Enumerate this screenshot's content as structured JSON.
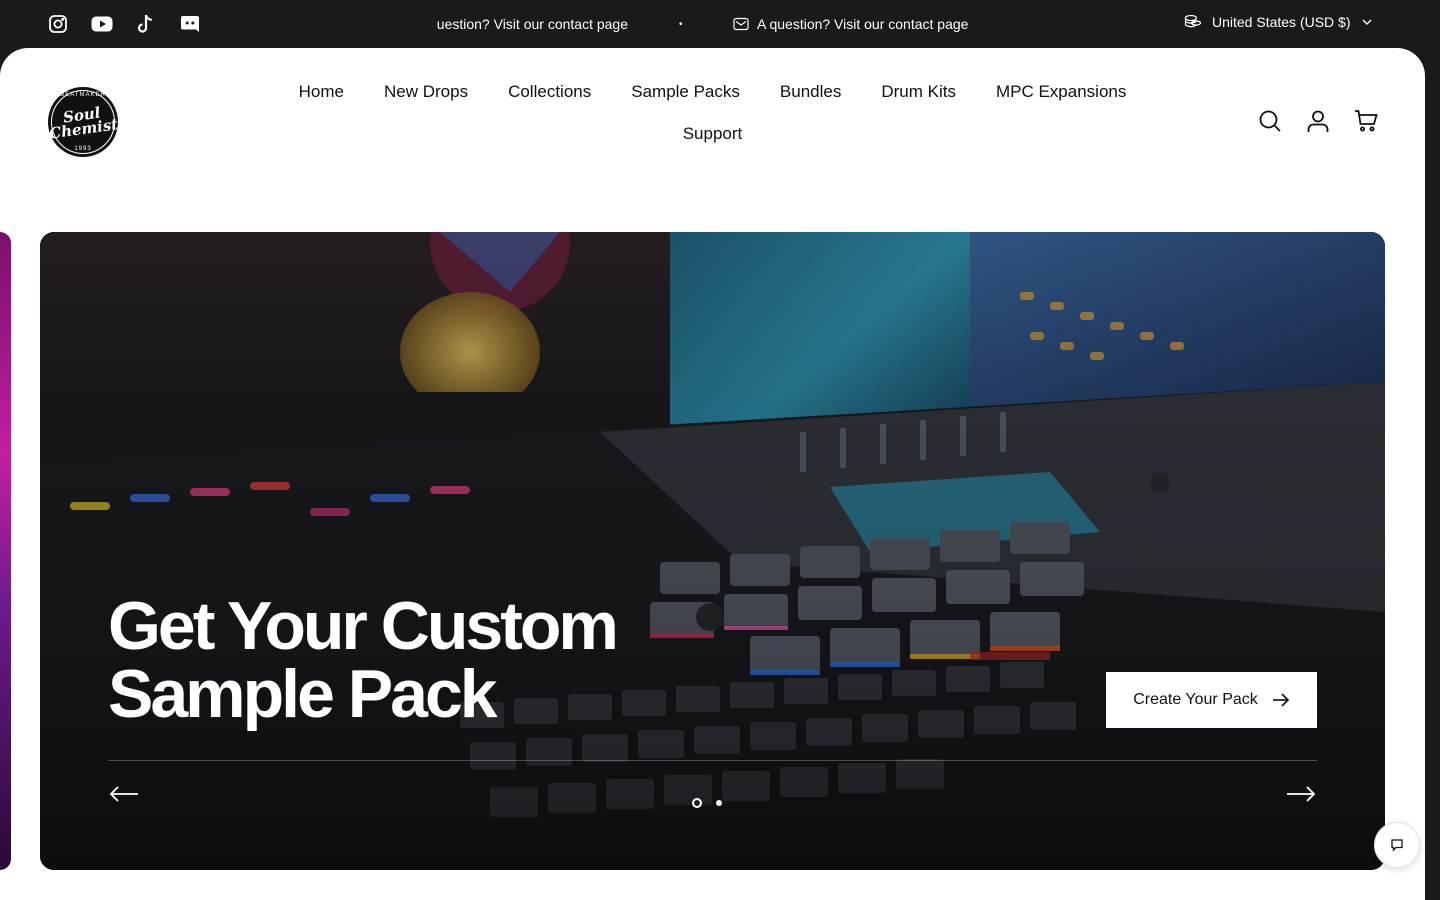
{
  "announcement": {
    "social_icons": [
      "instagram-icon",
      "youtube-icon",
      "tiktok-icon",
      "discord-icon"
    ],
    "message_clipped": "question? Visit our contact page",
    "separator": "•",
    "message": "A question? Visit our contact page",
    "currency_label": "United States (USD $)"
  },
  "header": {
    "logo": {
      "top_text": "BEATMAKER",
      "name_line1": "Soul",
      "name_line2": "Chemist",
      "year": "1993"
    },
    "nav": [
      "Home",
      "New Drops",
      "Collections",
      "Sample Packs",
      "Bundles",
      "Drum Kits",
      "MPC Expansions",
      "Support"
    ],
    "icons": [
      "search-icon",
      "account-icon",
      "cart-icon"
    ]
  },
  "hero": {
    "headline_line1": "Get Your Custom",
    "headline_line2": "Sample Pack",
    "cta_label": "Create Your Pack",
    "slide_count": 2,
    "active_slide": 1
  },
  "colors": {
    "topbar_bg": "#1a1a1a",
    "panel_bg": "#ffffff",
    "text": "#111111"
  }
}
